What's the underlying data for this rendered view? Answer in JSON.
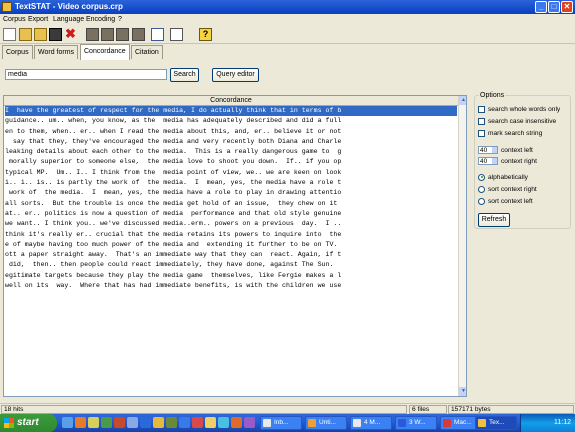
{
  "window": {
    "title": "TextSTAT - Video corpus.crp",
    "minimize": "_",
    "maximize": "□",
    "close": "✕"
  },
  "menu": [
    "Corpus",
    "Export",
    "Language",
    "Encoding",
    "?"
  ],
  "tabs": [
    "Corpus",
    "Word forms",
    "Concordance",
    "Citation"
  ],
  "search": {
    "value": "media",
    "search_label": "Search",
    "query_editor_label": "Query editor"
  },
  "concordance": {
    "header": "Concordance",
    "lines": [
      "I  have the greatest of respect for the media, I do actually think that in terms of b",
      "guidance.. um.. when, you know, as the  media has adequately described and did a full",
      "en to them, when.. er.. when I read the media about this, and, er.. believe it or not",
      "  say that they, they've encouraged the media and very recently both Diana and Charle",
      "leaking details about each other to the media.  This is a really dangerous game to  g",
      " morally superior to someone else,  the media love to shoot you down.  If.. if you op",
      "typical MP.  Um.. I.. I think from the  media point of view, we.. we are keen on look",
      "i.. i.. is.. is partly the work of  the media.  I  mean, yes, the media have a role t",
      " work of  the media.  I  mean, yes, the media have a role to play in drawing attentio",
      "all sorts.  But the trouble is once the media get hold of an issue,  they chew on it ",
      "at.. er.. politics is now a question of media  performance and that old style genuine",
      "we want.. I think you.. we've discussed media..erm.. powers on a previous  day.  I ..",
      "think it's really er.. crucial that the media retains its powers to inquire into  the",
      "e of maybe having too much power of the media and  extending it further to be on TV. ",
      "ott a paper straight away.  That's an immediate way that they can  react. Again, if t",
      " did,  then.. then people could react immediately, they have done, against The Sun.  ",
      "egitimate targets because they play the media game  themselves, like Fergie makes a l",
      "well on its  way.  Where that has had immediate benefits, is with the children we use"
    ]
  },
  "options": {
    "title": "Options",
    "search_whole_words_only": "search whole words only",
    "search_case_insensitive": "search case insensitive",
    "mark_search_string": "mark search string",
    "context_left_value": "40",
    "context_left_label": "context left",
    "context_right_value": "40",
    "context_right_label": "context right",
    "alphabetically": "alphabetically",
    "sort_context_right": "sort context right",
    "sort_context_left": "sort context left",
    "refresh_label": "Refresh"
  },
  "status": {
    "hits": "18 hits",
    "files": "6 files",
    "bytes": "157171 bytes"
  },
  "taskbar": {
    "start": "start",
    "tasks": [
      "Inb...",
      "Unti...",
      "4 M...",
      "3 W...",
      "Mac...",
      "Tex..."
    ],
    "clock": "11:12"
  },
  "colors": {
    "selection": "#316ac5",
    "titlebar": "#0a3fc0",
    "taskbar": "#245edb"
  }
}
